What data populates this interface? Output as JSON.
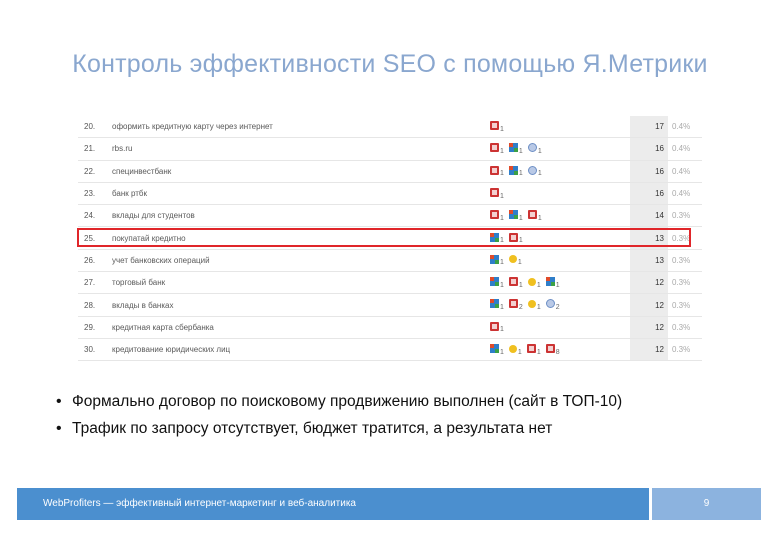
{
  "slide": {
    "title": "Контроль эффективности SEO с помощью Я.Метрики",
    "bullets": [
      "Формально договор по поисковому продвижению выполнен (сайт в ТОП-10)",
      "Трафик по запросу отсутствует, бюджет тратится, а результата нет"
    ]
  },
  "table": {
    "highlighted_row": 5,
    "rows": [
      {
        "num": "20.",
        "query": "оформить кредитную карту через интернет",
        "sources": [
          {
            "icon": "yandex-icon",
            "count": "1"
          }
        ],
        "count": "17",
        "pct": "0.4%"
      },
      {
        "num": "21.",
        "query": "rbs.ru",
        "sources": [
          {
            "icon": "yandex-icon",
            "count": "1"
          },
          {
            "icon": "google-icon",
            "count": "1"
          },
          {
            "icon": "mail-icon",
            "count": "1"
          }
        ],
        "count": "16",
        "pct": "0.4%"
      },
      {
        "num": "22.",
        "query": "специнвестбанк",
        "sources": [
          {
            "icon": "yandex-icon",
            "count": "1"
          },
          {
            "icon": "google-icon",
            "count": "1"
          },
          {
            "icon": "mail-icon",
            "count": "1"
          }
        ],
        "count": "16",
        "pct": "0.4%"
      },
      {
        "num": "23.",
        "query": "банк ртбк",
        "sources": [
          {
            "icon": "yandex-icon",
            "count": "1"
          }
        ],
        "count": "16",
        "pct": "0.4%"
      },
      {
        "num": "24.",
        "query": "вклады для студентов",
        "sources": [
          {
            "icon": "yandex-icon",
            "count": "1"
          },
          {
            "icon": "google-icon",
            "count": "1"
          },
          {
            "icon": "yandex-icon",
            "count": "1"
          }
        ],
        "count": "14",
        "pct": "0.3%"
      },
      {
        "num": "25.",
        "query": "покупатай кредитно",
        "sources": [
          {
            "icon": "google-icon",
            "count": "1"
          },
          {
            "icon": "yandex-icon",
            "count": "1"
          }
        ],
        "count": "13",
        "pct": "0.3%"
      },
      {
        "num": "26.",
        "query": "учет банковских операций",
        "sources": [
          {
            "icon": "google-icon",
            "count": "1"
          },
          {
            "icon": "rambler-icon",
            "count": "1"
          }
        ],
        "count": "13",
        "pct": "0.3%"
      },
      {
        "num": "27.",
        "query": "торговый банк",
        "sources": [
          {
            "icon": "google-icon",
            "count": "1"
          },
          {
            "icon": "yandex-icon",
            "count": "1"
          },
          {
            "icon": "rambler-icon",
            "count": "1"
          },
          {
            "icon": "google-icon",
            "count": "1"
          }
        ],
        "count": "12",
        "pct": "0.3%"
      },
      {
        "num": "28.",
        "query": "вклады в банках",
        "sources": [
          {
            "icon": "google-icon",
            "count": "1"
          },
          {
            "icon": "yandex-icon",
            "count": "2"
          },
          {
            "icon": "rambler-icon",
            "count": "1"
          },
          {
            "icon": "mail-icon",
            "count": "2"
          }
        ],
        "count": "12",
        "pct": "0.3%"
      },
      {
        "num": "29.",
        "query": "кредитная карта сбербанка",
        "sources": [
          {
            "icon": "yandex-icon",
            "count": "1"
          }
        ],
        "count": "12",
        "pct": "0.3%"
      },
      {
        "num": "30.",
        "query": "кредитование юридических лиц",
        "sources": [
          {
            "icon": "google-icon",
            "count": "1"
          },
          {
            "icon": "rambler-icon",
            "count": "1"
          },
          {
            "icon": "yandex-icon",
            "count": "1"
          },
          {
            "icon": "yandex-icon",
            "count": "8"
          }
        ],
        "count": "12",
        "pct": "0.3%"
      }
    ]
  },
  "footer": {
    "text": "WebProfiters — эффективный интернет-маркетинг и веб-аналитика",
    "page_number": "9"
  },
  "colors": {
    "title": "#8aa7cf",
    "highlight": "#e0262a",
    "footer_left": "#4b8fcf",
    "footer_right": "#8cb3df"
  }
}
